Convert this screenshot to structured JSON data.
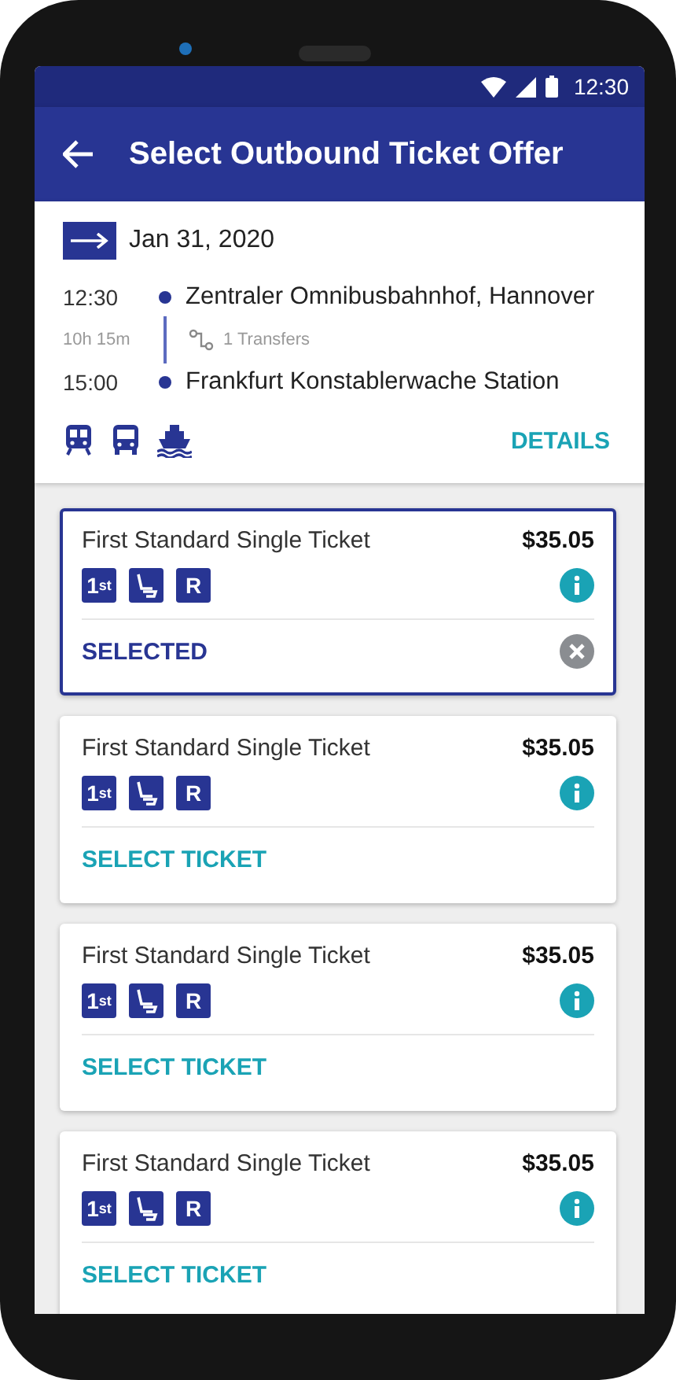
{
  "status_bar": {
    "time": "12:30"
  },
  "app_bar": {
    "title": "Select Outbound Ticket Offer"
  },
  "trip": {
    "date": "Jan 31, 2020",
    "departure": {
      "time": "12:30",
      "station": "Zentraler Omnibusbahnhof, Hannover"
    },
    "duration": "10h 15m",
    "transfers": "1 Transfers",
    "arrival": {
      "time": "15:00",
      "station": "Frankfurt Konstablerwache Station"
    },
    "modes": [
      {
        "kind": "train"
      },
      {
        "kind": "bus"
      },
      {
        "kind": "ferry"
      }
    ],
    "details_label": "DETAILS"
  },
  "offers": [
    {
      "name": "First Standard Single Ticket",
      "price": "$35.05",
      "features": [
        {
          "kind": "text",
          "label": "1$^{st}$"
        },
        {
          "kind": "seat"
        },
        {
          "kind": "text",
          "label": "R"
        }
      ],
      "selected": true,
      "action": "SELECTED"
    },
    {
      "name": "First Standard Single Ticket",
      "price": "$35.05",
      "features": [
        {
          "kind": "text",
          "label": "1$^{st}$"
        },
        {
          "kind": "seat"
        },
        {
          "kind": "text",
          "label": "R"
        }
      ],
      "selected": false,
      "action": "SELECT TICKET"
    },
    {
      "name": "First Standard Single Ticket",
      "price": "$35.05",
      "features": [
        {
          "kind": "text",
          "label": "1$^{st}$"
        },
        {
          "kind": "seat"
        },
        {
          "kind": "text",
          "label": "R"
        }
      ],
      "selected": false,
      "action": "SELECT TICKET"
    },
    {
      "name": "First Standard Single Ticket",
      "price": "$35.05",
      "features": [
        {
          "kind": "text",
          "label": "1$^{st}$"
        },
        {
          "kind": "seat"
        },
        {
          "kind": "text",
          "label": "R"
        }
      ],
      "selected": false,
      "action": "SELECT TICKET"
    }
  ]
}
